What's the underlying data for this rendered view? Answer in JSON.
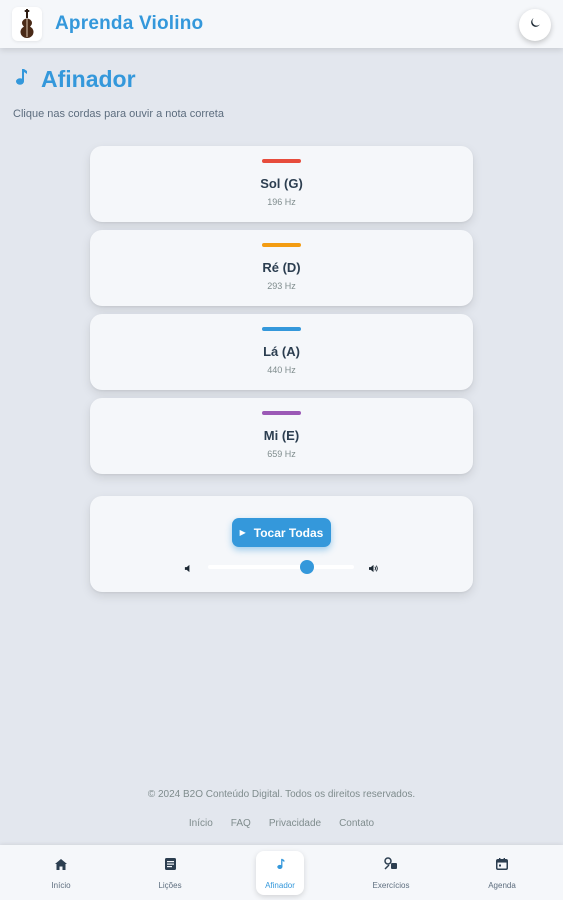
{
  "app": {
    "title": "Aprenda Violino",
    "logo_icon": "violin-icon",
    "theme_icon": "moon-icon"
  },
  "page": {
    "title": "Afinador",
    "title_icon": "music-note-icon",
    "subtitle": "Clique nas cordas para ouvir a nota correta"
  },
  "strings": [
    {
      "name": "Sol (G)",
      "freq": "196 Hz",
      "color": "#e74c3c"
    },
    {
      "name": "Ré (D)",
      "freq": "293 Hz",
      "color": "#f39c12"
    },
    {
      "name": "Lá (A)",
      "freq": "440 Hz",
      "color": "#3498db"
    },
    {
      "name": "Mi (E)",
      "freq": "659 Hz",
      "color": "#9b59b6"
    }
  ],
  "controls": {
    "play_all_label": "Tocar Todas",
    "play_icon": "play-icon",
    "volume_low_icon": "volume-low-icon",
    "volume_high_icon": "volume-high-icon",
    "volume_level": 0.68
  },
  "footer": {
    "copyright": "© 2024 B2O Conteúdo Digital. Todos os direitos reservados.",
    "links": [
      "Início",
      "FAQ",
      "Privacidade",
      "Contato"
    ]
  },
  "nav": {
    "items": [
      {
        "label": "Início",
        "icon": "home-icon"
      },
      {
        "label": "Lições",
        "icon": "lessons-icon"
      },
      {
        "label": "Afinador",
        "icon": "music-note-icon",
        "active": true
      },
      {
        "label": "Exercícios",
        "icon": "exercises-icon"
      },
      {
        "label": "Agenda",
        "icon": "calendar-icon"
      }
    ]
  },
  "colors": {
    "accent": "#3498db",
    "background": "#e3e7ee",
    "card": "#f5f7fa"
  }
}
